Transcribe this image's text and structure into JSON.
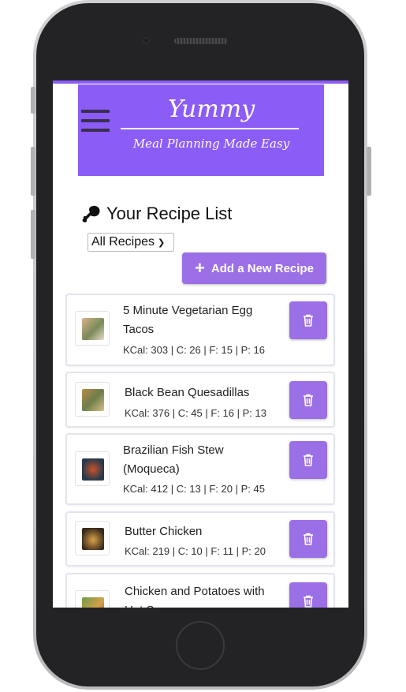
{
  "brand": {
    "name": "Yummy",
    "tagline": "Meal Planning Made Easy"
  },
  "page": {
    "title": "Your Recipe List",
    "filter_value": "All Recipes",
    "add_button_label": "Add a New Recipe"
  },
  "recipes": [
    {
      "name": "5 Minute Vegetarian Egg Tacos",
      "macros": "KCal: 303 | C: 26 | F: 15 | P: 16"
    },
    {
      "name": "Black Bean Quesadillas",
      "macros": "KCal: 376 | C: 45 | F: 16 | P: 13"
    },
    {
      "name": "Brazilian Fish Stew (Moqueca)",
      "macros": "KCal: 412 | C: 13 | F: 20 | P: 45"
    },
    {
      "name": "Butter Chicken",
      "macros": "KCal: 219 | C: 10 | F: 11 | P: 20"
    },
    {
      "name": "Chicken and Potatoes with Hot Sauce",
      "macros": ""
    }
  ],
  "colors": {
    "accent": "#8b5cf6",
    "button": "#9b6fe6"
  },
  "icons": {
    "menu": "hamburger-icon",
    "title": "drumstick-icon",
    "add": "plus-icon",
    "delete": "trash-icon"
  }
}
